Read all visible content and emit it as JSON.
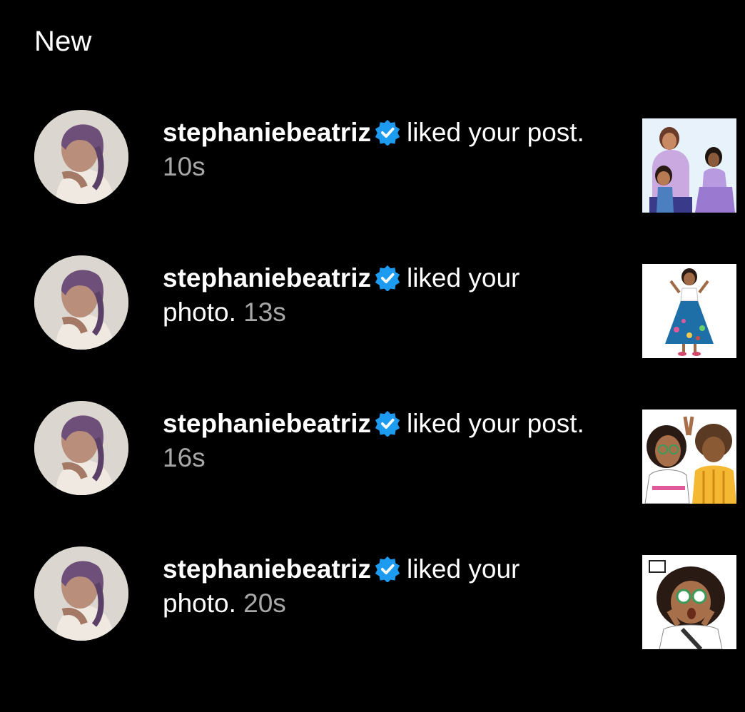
{
  "section": {
    "title": "New"
  },
  "notifications": [
    {
      "username": "stephaniebeatriz",
      "action": "liked your post.",
      "action_line1": "liked your post.",
      "action_line2": "",
      "time": "10s",
      "thumbnail_icon": "family-illustration",
      "layout": "action-inline"
    },
    {
      "username": "stephaniebeatriz",
      "action": "liked your photo.",
      "action_line1": "liked your",
      "action_line2": "photo.",
      "time": "13s",
      "thumbnail_icon": "dress-character-illustration",
      "layout": "action-wrapped"
    },
    {
      "username": "stephaniebeatriz",
      "action": "liked your post.",
      "action_line1": "liked your post.",
      "action_line2": "",
      "time": "16s",
      "thumbnail_icon": "two-characters-illustration",
      "layout": "action-inline"
    },
    {
      "username": "stephaniebeatriz",
      "action": "liked your photo.",
      "action_line1": "liked your",
      "action_line2": "photo.",
      "time": "20s",
      "thumbnail_icon": "surprised-character-illustration",
      "layout": "action-wrapped"
    }
  ],
  "colors": {
    "background": "#000000",
    "text": "#ffffff",
    "muted": "#a8a8a8",
    "verified": "#1d9bf0"
  }
}
